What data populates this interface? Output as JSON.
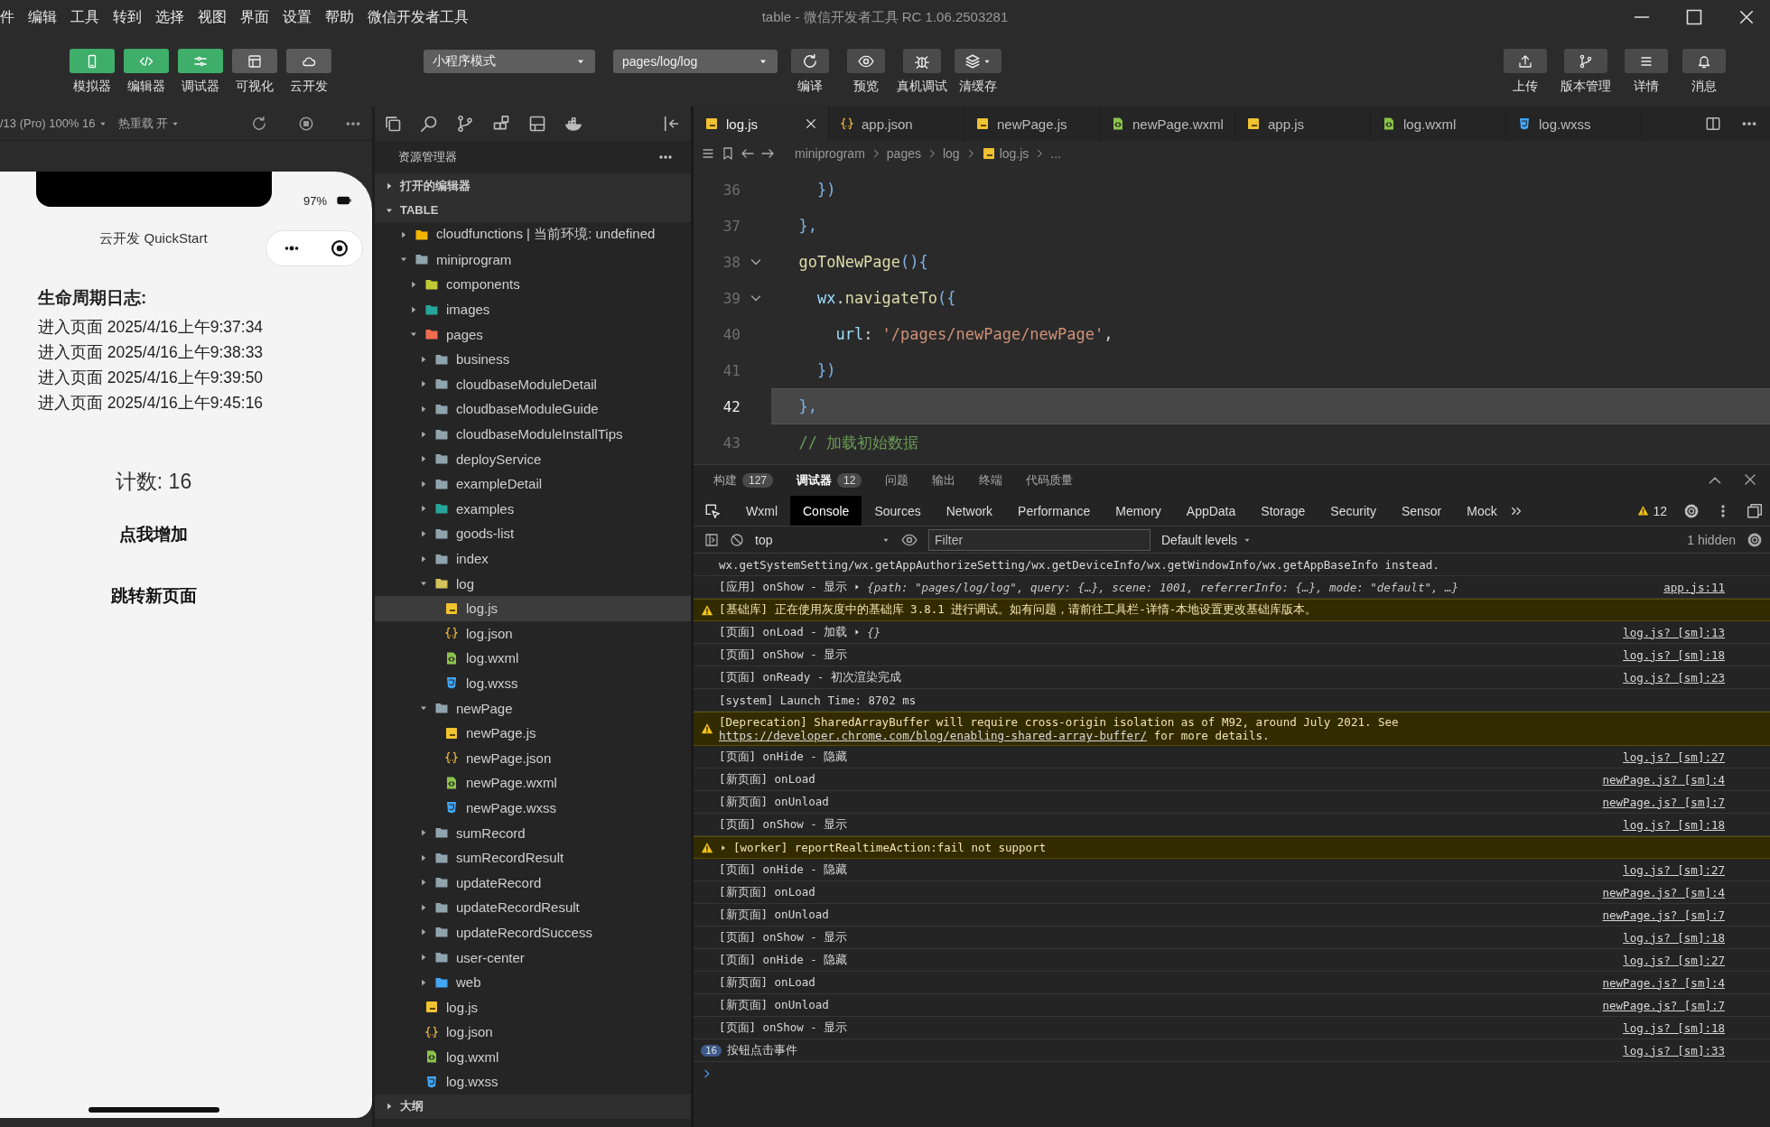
{
  "menu": [
    "件",
    "编辑",
    "工具",
    "转到",
    "选择",
    "视图",
    "界面",
    "设置",
    "帮助",
    "微信开发者工具"
  ],
  "window": {
    "title": "table - 微信开发者工具 RC 1.06.2503281"
  },
  "toolbar": {
    "view_buttons": [
      {
        "label": "模拟器",
        "on": true
      },
      {
        "label": "编辑器",
        "on": true
      },
      {
        "label": "调试器",
        "on": true
      },
      {
        "label": "可视化",
        "on": false
      },
      {
        "label": "云开发",
        "on": false
      }
    ],
    "mode_select": "小程序模式",
    "page_select": "pages/log/log",
    "actions": [
      "编译",
      "预览",
      "真机调试",
      "清缓存"
    ],
    "right_actions": [
      "上传",
      "版本管理",
      "详情",
      "消息"
    ]
  },
  "simulator": {
    "device": "/13 (Pro) 100% 16",
    "hot_reload": "热重载 开",
    "battery": "97%",
    "nav_title": "云开发 QuickStart",
    "log_title": "生命周期日志:",
    "log_entries": [
      "进入页面 2025/4/16上午9:37:34",
      "进入页面 2025/4/16上午9:38:33",
      "进入页面 2025/4/16上午9:39:50",
      "进入页面 2025/4/16上午9:45:16"
    ],
    "counter": "计数: 16",
    "buttons": [
      "点我增加",
      "跳转新页面"
    ]
  },
  "explorer": {
    "title": "资源管理器",
    "sections": [
      {
        "label": "打开的编辑器",
        "expanded": false
      },
      {
        "label": "TABLE",
        "expanded": true,
        "tree": [
          {
            "name": "cloudfunctions | 当前环境: undefined",
            "kind": "cloud",
            "expanded": false,
            "selected": false
          },
          {
            "name": "miniprogram",
            "kind": "folder",
            "expanded": true,
            "selected": false,
            "children": [
              {
                "name": "components",
                "kind": "components",
                "expanded": false,
                "selected": false
              },
              {
                "name": "images",
                "kind": "images",
                "expanded": false,
                "selected": false
              },
              {
                "name": "pages",
                "kind": "pages",
                "expanded": true,
                "selected": false,
                "children": [
                  {
                    "name": "business",
                    "kind": "folder",
                    "expanded": false,
                    "selected": false
                  },
                  {
                    "name": "cloudbaseModuleDetail",
                    "kind": "folder",
                    "expanded": false,
                    "selected": false
                  },
                  {
                    "name": "cloudbaseModuleGuide",
                    "kind": "folder",
                    "expanded": false,
                    "selected": false
                  },
                  {
                    "name": "cloudbaseModuleInstallTips",
                    "kind": "folder",
                    "expanded": false,
                    "selected": false
                  },
                  {
                    "name": "deployService",
                    "kind": "folder",
                    "expanded": false,
                    "selected": false
                  },
                  {
                    "name": "exampleDetail",
                    "kind": "folder",
                    "expanded": false,
                    "selected": false
                  },
                  {
                    "name": "examples",
                    "kind": "images",
                    "expanded": false,
                    "selected": false
                  },
                  {
                    "name": "goods-list",
                    "kind": "folder",
                    "expanded": false,
                    "selected": false
                  },
                  {
                    "name": "index",
                    "kind": "folder",
                    "expanded": false,
                    "selected": false
                  },
                  {
                    "name": "log",
                    "kind": "notes",
                    "expanded": true,
                    "selected": false,
                    "children": [
                      {
                        "name": "log.js",
                        "kind": "js",
                        "selected": true
                      },
                      {
                        "name": "log.json",
                        "kind": "json",
                        "selected": false
                      },
                      {
                        "name": "log.wxml",
                        "kind": "wxml",
                        "selected": false
                      },
                      {
                        "name": "log.wxss",
                        "kind": "wxss",
                        "selected": false
                      }
                    ]
                  },
                  {
                    "name": "newPage",
                    "kind": "folder",
                    "expanded": true,
                    "selected": false,
                    "children": [
                      {
                        "name": "newPage.js",
                        "kind": "js",
                        "selected": false
                      },
                      {
                        "name": "newPage.json",
                        "kind": "json",
                        "selected": false
                      },
                      {
                        "name": "newPage.wxml",
                        "kind": "wxml",
                        "selected": false
                      },
                      {
                        "name": "newPage.wxss",
                        "kind": "wxss",
                        "selected": false
                      }
                    ]
                  },
                  {
                    "name": "sumRecord",
                    "kind": "folder",
                    "expanded": false,
                    "selected": false
                  },
                  {
                    "name": "sumRecordResult",
                    "kind": "folder",
                    "expanded": false,
                    "selected": false
                  },
                  {
                    "name": "updateRecord",
                    "kind": "folder",
                    "expanded": false,
                    "selected": false
                  },
                  {
                    "name": "updateRecordResult",
                    "kind": "folder",
                    "expanded": false,
                    "selected": false
                  },
                  {
                    "name": "updateRecordSuccess",
                    "kind": "folder",
                    "expanded": false,
                    "selected": false
                  },
                  {
                    "name": "user-center",
                    "kind": "folder",
                    "expanded": false,
                    "selected": false
                  },
                  {
                    "name": "web",
                    "kind": "web",
                    "expanded": false,
                    "selected": false
                  }
                ]
              },
              {
                "name": "log.js",
                "kind": "js",
                "selected": false
              },
              {
                "name": "log.json",
                "kind": "json",
                "selected": false
              },
              {
                "name": "log.wxml",
                "kind": "wxml",
                "selected": false
              },
              {
                "name": "log.wxss",
                "kind": "wxss",
                "selected": false
              }
            ]
          }
        ]
      },
      {
        "label": "大纲",
        "expanded": false
      }
    ]
  },
  "editor": {
    "tabs": [
      {
        "name": "log.js",
        "kind": "js",
        "selected": true
      },
      {
        "name": "app.json",
        "kind": "json",
        "selected": false
      },
      {
        "name": "newPage.js",
        "kind": "js",
        "selected": false
      },
      {
        "name": "newPage.wxml",
        "kind": "wxml",
        "selected": false
      },
      {
        "name": "app.js",
        "kind": "js",
        "selected": false
      },
      {
        "name": "log.wxml",
        "kind": "wxml",
        "selected": false
      },
      {
        "name": "log.wxss",
        "kind": "wxss",
        "selected": false
      }
    ],
    "breadcrumb": [
      "miniprogram",
      "pages",
      "log",
      "log.js",
      "..."
    ],
    "lines": [
      {
        "number": "36",
        "current": false,
        "foldable": false,
        "tokens": [
          {
            "text": "    })",
            "kind": "bracket"
          }
        ]
      },
      {
        "number": "37",
        "current": false,
        "foldable": false,
        "tokens": [
          {
            "text": "  },",
            "kind": "bracket"
          }
        ]
      },
      {
        "number": "38",
        "current": false,
        "foldable": true,
        "tokens": [
          {
            "text": "  goToNewPage",
            "kind": "function"
          },
          {
            "text": "(){",
            "kind": "bracket"
          }
        ]
      },
      {
        "number": "39",
        "current": false,
        "foldable": true,
        "tokens": [
          {
            "text": "    wx",
            "kind": "variable"
          },
          {
            "text": ".",
            "kind": "plain"
          },
          {
            "text": "navigateTo",
            "kind": "function"
          },
          {
            "text": "({",
            "kind": "bracket"
          }
        ]
      },
      {
        "number": "40",
        "current": false,
        "foldable": false,
        "tokens": [
          {
            "text": "      url",
            "kind": "variable"
          },
          {
            "text": ": ",
            "kind": "plain"
          },
          {
            "text": "'/pages/newPage/newPage'",
            "kind": "string"
          },
          {
            "text": ",",
            "kind": "plain"
          }
        ]
      },
      {
        "number": "41",
        "current": false,
        "foldable": false,
        "tokens": [
          {
            "text": "    })",
            "kind": "bracket"
          }
        ]
      },
      {
        "number": "42",
        "current": true,
        "foldable": false,
        "tokens": [
          {
            "text": "  },",
            "kind": "bracket"
          }
        ]
      },
      {
        "number": "43",
        "current": false,
        "foldable": false,
        "tokens": [
          {
            "text": "  // 加载初始数据",
            "kind": "comment"
          }
        ]
      }
    ]
  },
  "debugger": {
    "panel_tabs": [
      {
        "label": "构建",
        "count": "127",
        "selected": false
      },
      {
        "label": "调试器",
        "count": "12",
        "selected": true
      },
      {
        "label": "问题",
        "selected": false
      },
      {
        "label": "输出",
        "selected": false
      },
      {
        "label": "终端",
        "selected": false
      },
      {
        "label": "代码质量",
        "selected": false
      }
    ],
    "devtools_tabs": [
      {
        "label": "Wxml",
        "selected": false
      },
      {
        "label": "Console",
        "selected": true
      },
      {
        "label": "Sources",
        "selected": false
      },
      {
        "label": "Network",
        "selected": false
      },
      {
        "label": "Performance",
        "selected": false
      },
      {
        "label": "Memory",
        "selected": false
      },
      {
        "label": "AppData",
        "selected": false
      },
      {
        "label": "Storage",
        "selected": false
      },
      {
        "label": "Security",
        "selected": false
      },
      {
        "label": "Sensor",
        "selected": false
      },
      {
        "label": "Mock",
        "selected": false
      }
    ],
    "warnings": "12",
    "context": "top",
    "filter_placeholder": "Filter",
    "levels": "Default levels",
    "hidden": "1 hidden",
    "messages": [
      {
        "kind": "log",
        "text": "wx.getSystemSetting/wx.getAppAuthorizeSetting/wx.getDeviceInfo/wx.getWindowInfo/wx.getAppBaseInfo instead."
      },
      {
        "kind": "log",
        "text": "[应用] onShow - 显示",
        "object": "{path: \"pages/log/log\", query: {…}, scene: 1001, referrerInfo: {…}, mode: \"default\", …}",
        "source": "app.js:11"
      },
      {
        "kind": "warning",
        "text": "[基础库] 正在使用灰度中的基础库 3.8.1 进行调试。如有问题，请前往工具栏-详情-本地设置更改基础库版本。"
      },
      {
        "kind": "log",
        "text": "[页面] onLoad - 加载",
        "object": "{}",
        "source": "log.js? [sm]:13"
      },
      {
        "kind": "log",
        "text": "[页面] onShow - 显示",
        "source": "log.js? [sm]:18"
      },
      {
        "kind": "log",
        "text": "[页面] onReady - 初次渲染完成",
        "source": "log.js? [sm]:23"
      },
      {
        "kind": "log",
        "text": "[system] Launch Time: 8702 ms"
      },
      {
        "kind": "warning",
        "text": "[Deprecation] SharedArrayBuffer will require cross-origin isolation as of M92, around July 2021. See ",
        "link": "https://developer.chrome.com/blog/enabling-shared-array-buffer/",
        "after": " for more details."
      },
      {
        "kind": "log",
        "text": "[页面] onHide - 隐藏",
        "source": "log.js? [sm]:27"
      },
      {
        "kind": "log",
        "text": "[新页面] onLoad",
        "source": "newPage.js? [sm]:4"
      },
      {
        "kind": "log",
        "text": "[新页面] onUnload",
        "source": "newPage.js? [sm]:7"
      },
      {
        "kind": "log",
        "text": "[页面] onShow - 显示",
        "source": "log.js? [sm]:18"
      },
      {
        "kind": "warning",
        "text": "[worker] reportRealtimeAction:fail not support",
        "expandable": true
      },
      {
        "kind": "log",
        "text": "[页面] onHide - 隐藏",
        "source": "log.js? [sm]:27"
      },
      {
        "kind": "log",
        "text": "[新页面] onLoad",
        "source": "newPage.js? [sm]:4"
      },
      {
        "kind": "log",
        "text": "[新页面] onUnload",
        "source": "newPage.js? [sm]:7"
      },
      {
        "kind": "log",
        "text": "[页面] onShow - 显示",
        "source": "log.js? [sm]:18"
      },
      {
        "kind": "log",
        "text": "[页面] onHide - 隐藏",
        "source": "log.js? [sm]:27"
      },
      {
        "kind": "log",
        "text": "[新页面] onLoad",
        "source": "newPage.js? [sm]:4"
      },
      {
        "kind": "log",
        "text": "[新页面] onUnload",
        "source": "newPage.js? [sm]:7"
      },
      {
        "kind": "log",
        "text": "[页面] onShow - 显示",
        "source": "log.js? [sm]:18"
      },
      {
        "kind": "log",
        "text": "按钮点击事件",
        "count": "16",
        "source": "log.js? [sm]:33"
      }
    ]
  }
}
